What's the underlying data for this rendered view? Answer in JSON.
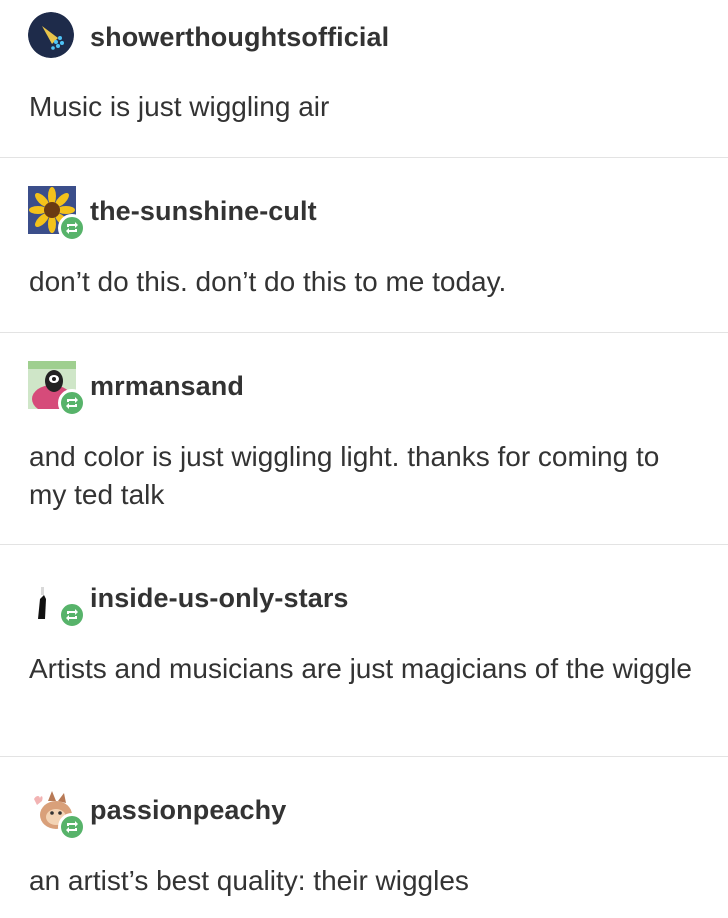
{
  "posts": [
    {
      "username": "showerthoughtsofficial",
      "text": "Music is just wiggling air",
      "avatar_icon": "shower-head-icon",
      "reblogged": false
    },
    {
      "username": "the-sunshine-cult",
      "text": "don’t do this. don’t do this to me today.",
      "avatar_icon": "sunflower-icon",
      "reblogged": true
    },
    {
      "username": "mrmansand",
      "text": "and color is just wiggling light. thanks for coming to my ted talk",
      "avatar_icon": "cartoon-character-icon",
      "reblogged": true
    },
    {
      "username": "inside-us-only-stars",
      "text": "Artists and musicians are just magicians of the wiggle",
      "avatar_icon": "bottle-icon",
      "reblogged": true
    },
    {
      "username": "passionpeachy",
      "text": "an artist’s best quality: their wiggles",
      "avatar_icon": "peach-character-icon",
      "reblogged": true
    }
  ],
  "colors": {
    "reblog_badge": "#57b36a",
    "divider": "#e3e3e3",
    "text": "#333333"
  }
}
